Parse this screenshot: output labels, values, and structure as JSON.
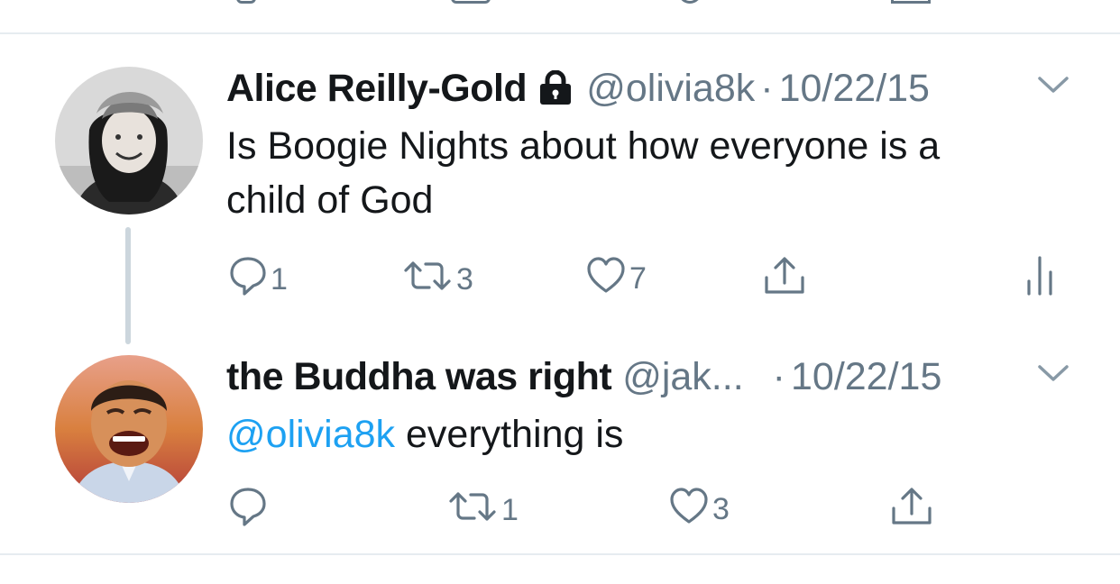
{
  "tweets": [
    {
      "name": "Alice Reilly-Gold",
      "handle": "@olivia8k",
      "separator": "·",
      "date": "10/22/15",
      "text_line1": "Is Boogie Nights about how everyone is a",
      "text_line2": "child of God",
      "reply_count": "1",
      "retweet_count": "3",
      "like_count": "7",
      "icons": [
        "lock-icon",
        "chevron-down-icon",
        "reply-icon",
        "retweet-icon",
        "like-icon",
        "share-icon",
        "analytics-icon"
      ]
    },
    {
      "name": "the Buddha was right",
      "handle": "@jak...",
      "separator": "·",
      "date": "10/22/15",
      "mention": "@olivia8k",
      "text": " everything is",
      "retweet_count": "1",
      "like_count": "3",
      "icons": [
        "chevron-down-icon",
        "reply-icon",
        "retweet-icon",
        "like-icon",
        "share-icon"
      ]
    }
  ],
  "colors": {
    "text": "#14171a",
    "secondary": "#657786",
    "link": "#1da1f2",
    "divider": "#e6ecf0",
    "thread_line": "#ccd6dd"
  }
}
